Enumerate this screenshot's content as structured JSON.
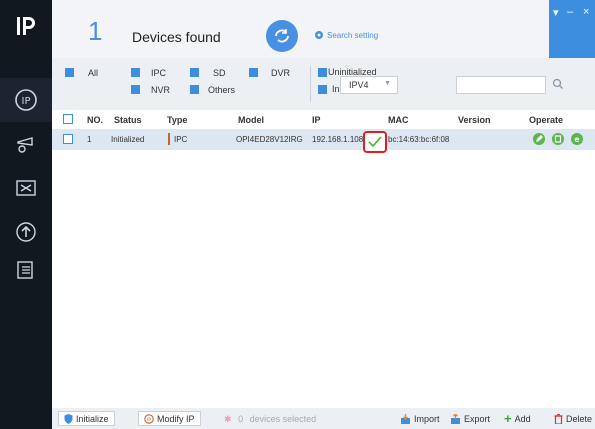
{
  "app": {
    "logo_icon": "ip-logo-icon"
  },
  "header": {
    "device_count": "1",
    "count_label": "Devices found",
    "search_setting": "Search setting",
    "window_controls": [
      "▾",
      "–",
      "×"
    ]
  },
  "filters": {
    "items": [
      {
        "label": "All"
      },
      {
        "label": "IPC"
      },
      {
        "label": "SD"
      },
      {
        "label": "DVR"
      },
      {
        "label": "NVR"
      },
      {
        "label": "Others"
      },
      {
        "label": "Uninitialized"
      },
      {
        "label": "Initialized"
      }
    ],
    "ip_version": "IPV4",
    "search_value": ""
  },
  "table": {
    "headers": [
      "NO.",
      "Status",
      "Type",
      "Model",
      "IP",
      "MAC",
      "Version",
      "Operate"
    ],
    "rows": [
      {
        "no": "1",
        "status": "Initialized",
        "type": "IPC",
        "model": "OPI4ED28V12IRG",
        "ip": "192.168.1.108",
        "mac": "bc:14:63:bc:6f:08",
        "version": ""
      }
    ]
  },
  "bottom": {
    "initialize": "Initialize",
    "modify_ip": "Modify IP",
    "status_count": "0",
    "status_text": "devices selected",
    "import": "Import",
    "export": "Export",
    "add": "Add",
    "delete": "Delete"
  },
  "colors": {
    "accent": "#3e8ee0",
    "sidebar": "#121820",
    "row_selected": "#dce7f2",
    "highlight": "#e02020",
    "operate": "#5ab54a"
  }
}
